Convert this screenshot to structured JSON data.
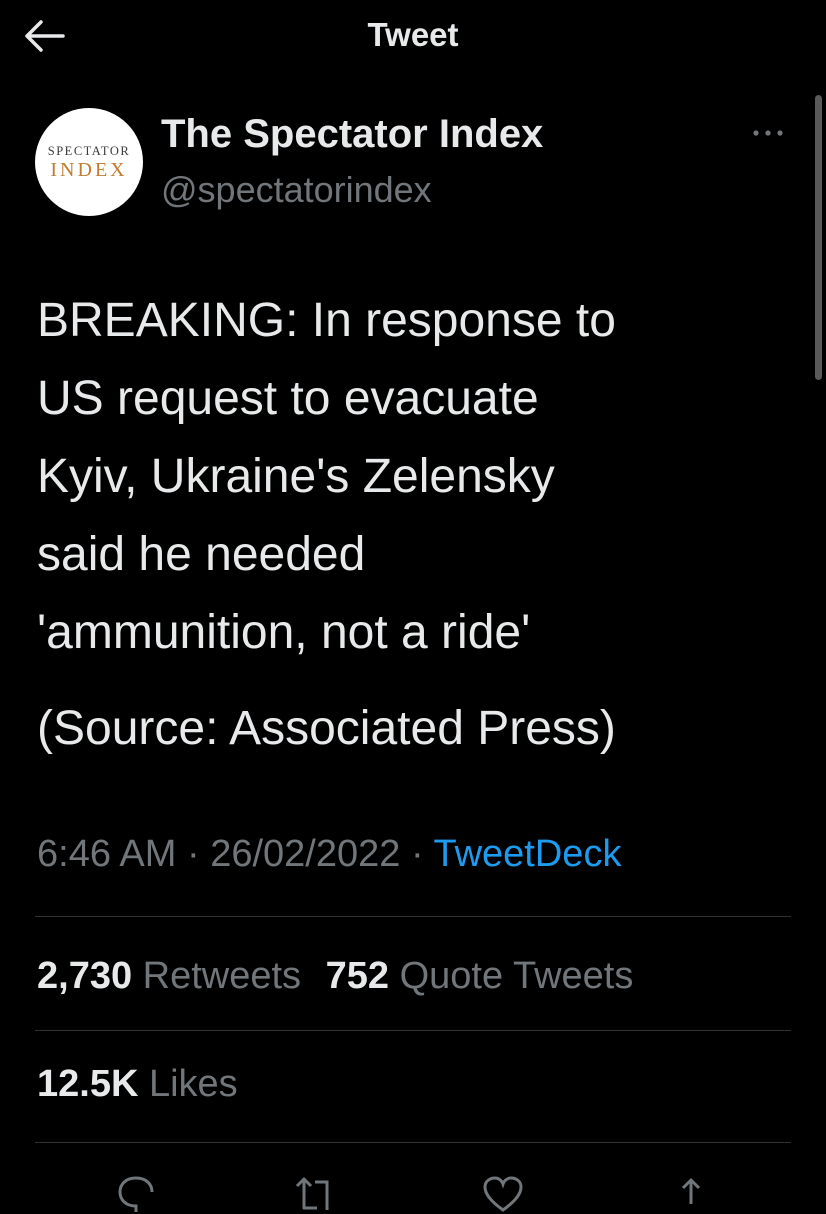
{
  "header": {
    "title": "Tweet",
    "back_icon": "arrow-left-icon"
  },
  "author": {
    "display_name": "The Spectator Index",
    "handle": "@spectatorindex",
    "avatar_line1": "SPECTATOR",
    "avatar_line2": "INDEX"
  },
  "tweet": {
    "text": "BREAKING: In response to\nUS request to evacuate\nKyiv, Ukraine's Zelensky\nsaid he needed\n'ammunition, not a ride'",
    "source_line": "(Source: Associated Press)",
    "time": "6:46 AM",
    "date": "26/02/2022",
    "separator": "·",
    "client": "TweetDeck"
  },
  "stats": {
    "retweets_count": "2,730",
    "retweets_label": "Retweets",
    "quotes_count": "752",
    "quotes_label": "Quote Tweets",
    "likes_count": "12.5K",
    "likes_label": "Likes"
  },
  "actions": [
    "reply-icon",
    "retweet-icon",
    "like-icon",
    "share-icon"
  ],
  "colors": {
    "background": "#000000",
    "primary_text": "#e7e9ea",
    "secondary_text": "#71767b",
    "link": "#1d9bf0",
    "divider": "#2f3336"
  }
}
